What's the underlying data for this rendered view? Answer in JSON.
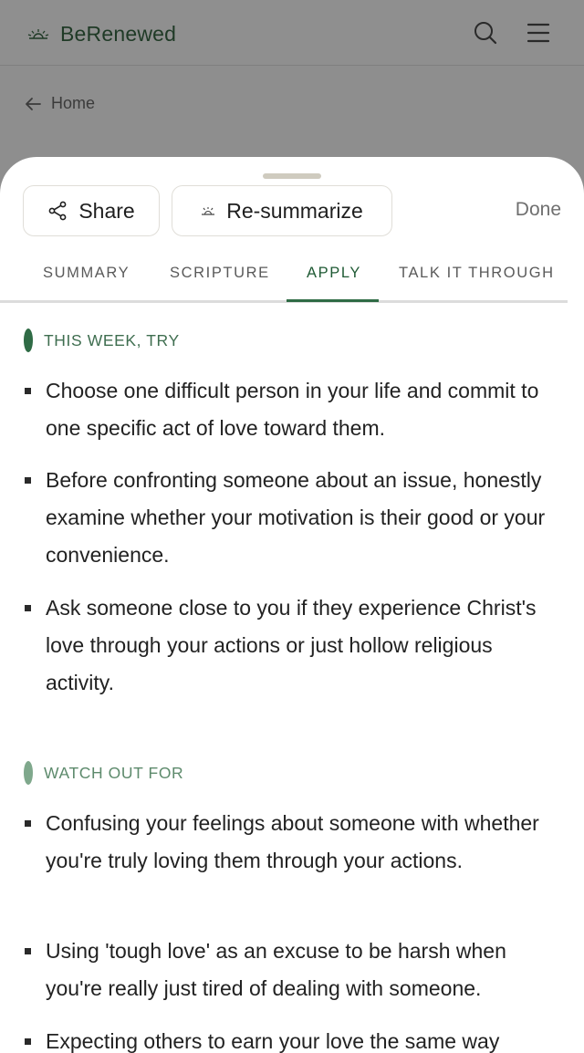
{
  "app": {
    "brand_name": "BeRenewed",
    "brand_icon": "sunrise-icon",
    "accent_color": "#2f6b45"
  },
  "header": {
    "icons": [
      "search-icon",
      "menu-icon"
    ]
  },
  "breadcrumb": {
    "label": "Home",
    "icon": "arrow-left-icon"
  },
  "sheet": {
    "share_label": "Share",
    "resummarize_label": "Re-summarize",
    "done_label": "Done",
    "tabs": [
      {
        "label": "SUMMARY",
        "active": false
      },
      {
        "label": "SCRIPTURE",
        "active": false
      },
      {
        "label": "APPLY",
        "active": true
      },
      {
        "label": "TALK IT THROUGH",
        "active": false
      }
    ]
  },
  "sections": [
    {
      "title": "THIS WEEK, TRY",
      "color": "#2f6b45",
      "items": [
        "Choose one difficult person in your life and commit to one specific act of love toward them.",
        "Before confronting someone about an issue, honestly examine whether your motivation is their good or your convenience.",
        "Ask someone close to you if they experience Christ's love through your actions or just hollow religious activity."
      ]
    },
    {
      "title": "WATCH OUT FOR",
      "color": "#7fa88c",
      "items": [
        "Confusing your feelings about someone with whether you're truly loving them through your actions.",
        "Using 'tough love' as an excuse to be harsh when you're really just tired of dealing with someone.",
        "Expecting others to earn your love the same way"
      ]
    }
  ]
}
